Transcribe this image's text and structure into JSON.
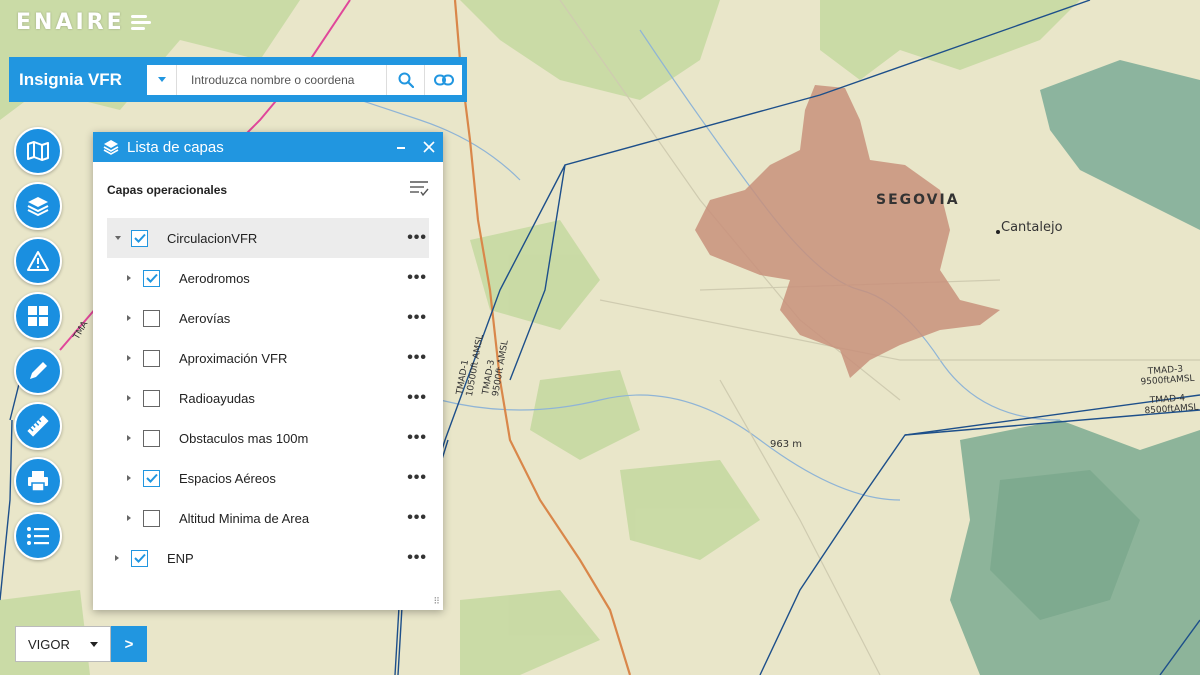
{
  "logo": {
    "text": "ENAIRE"
  },
  "search": {
    "app_title": "Insignia VFR",
    "placeholder": "Introduzca nombre o coordena"
  },
  "toolbar": {
    "buttons": [
      "map-icon",
      "layers-icon",
      "warning-icon",
      "grid-icon",
      "pencil-icon",
      "ruler-icon",
      "print-icon",
      "list-icon"
    ]
  },
  "layer_panel": {
    "title": "Lista de capas",
    "section_title": "Capas operacionales",
    "layers": [
      {
        "label": "CirculacionVFR",
        "checked": true,
        "expanded": true,
        "level": 0
      },
      {
        "label": "Aerodromos",
        "checked": true,
        "expanded": false,
        "level": 1
      },
      {
        "label": "Aerovías",
        "checked": false,
        "expanded": false,
        "level": 1
      },
      {
        "label": "Aproximación VFR",
        "checked": false,
        "expanded": false,
        "level": 1
      },
      {
        "label": "Radioayudas",
        "checked": false,
        "expanded": false,
        "level": 1
      },
      {
        "label": "Obstaculos mas 100m",
        "checked": false,
        "expanded": false,
        "level": 1
      },
      {
        "label": "Espacios Aéreos",
        "checked": true,
        "expanded": false,
        "level": 1
      },
      {
        "label": "Altitud Minima de Area",
        "checked": false,
        "expanded": false,
        "level": 1
      },
      {
        "label": "ENP",
        "checked": true,
        "expanded": false,
        "level": 0
      }
    ],
    "more_label": "•••"
  },
  "vigor": {
    "selected": "VIGOR",
    "go_label": ">"
  },
  "map": {
    "labels": {
      "segovia": "SEGOVIA",
      "cantalejo": "Cantalejo",
      "elevation": "963 m",
      "tmad_left_1": "TMAD-1",
      "tmad_left_1_alt": "10500ft AMSL",
      "tmad_left_3": "TMAD-3",
      "tmad_left_3_alt": "9500ft AMSL",
      "tmad_right_3": "TMAD-3",
      "tmad_right_3_alt": "9500ftAMSL",
      "tmad_right_4": "TMAD-4",
      "tmad_right_4_alt": "8500ftAMSL",
      "tma_pink": "TMA"
    },
    "colors": {
      "terrain": "#e8e4c8",
      "forest": "#b9d19c",
      "mountain": "#86b09a",
      "protected_area": "#c9907a",
      "airspace": "#1d4f8a",
      "tma_pink": "#e0479a",
      "road": "#d9874a"
    }
  }
}
